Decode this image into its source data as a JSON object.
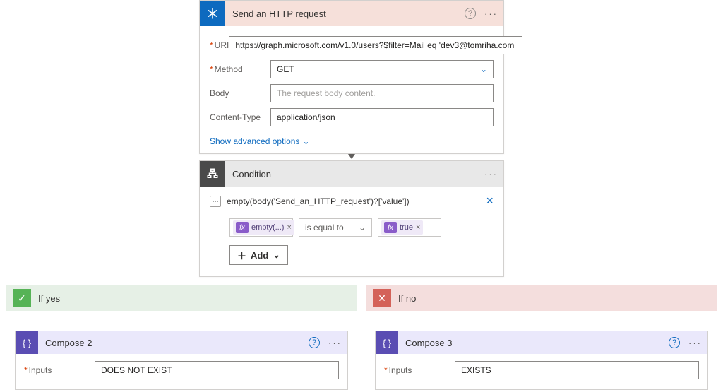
{
  "http": {
    "title": "Send an HTTP request",
    "fields": {
      "uri_label": "URI",
      "uri_value": "https://graph.microsoft.com/v1.0/users?$filter=Mail eq 'dev3@tomriha.com'",
      "method_label": "Method",
      "method_value": "GET",
      "body_label": "Body",
      "body_placeholder": "The request body content.",
      "ct_label": "Content-Type",
      "ct_value": "application/json"
    },
    "advanced_link": "Show advanced options"
  },
  "condition": {
    "title": "Condition",
    "expression": "empty(body('Send_an_HTTP_request')?['value'])",
    "left_pill": "empty(...)",
    "operator": "is equal to",
    "right_pill": "true",
    "add_label": "Add"
  },
  "branches": {
    "yes_title": "If yes",
    "no_title": "If no",
    "compose2": {
      "title": "Compose 2",
      "inputs_label": "Inputs",
      "inputs_value": "DOES NOT EXIST"
    },
    "compose3": {
      "title": "Compose 3",
      "inputs_label": "Inputs",
      "inputs_value": "EXISTS"
    }
  }
}
